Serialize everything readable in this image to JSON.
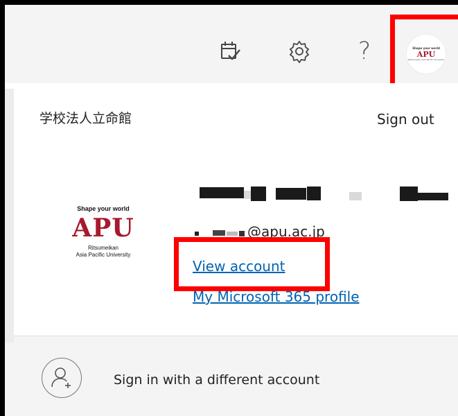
{
  "header": {
    "calendar_icon": "calendar-check-icon",
    "settings_icon": "gear-icon",
    "help_glyph": "?",
    "avatar": {
      "tagline": "Shape your world",
      "name": "APU",
      "subtitle": "Ritsumeikan Asia Pacific University"
    }
  },
  "account": {
    "organization": "学校法人立命館",
    "sign_out": "Sign out",
    "logo": {
      "tagline": "Shape your world",
      "name": "APU",
      "subtitle_line1": "Ritsumeikan",
      "subtitle_line2": "Asia Pacific University"
    },
    "email_domain": "@apu.ac.jp",
    "view_account": "View account",
    "profile_link": "My Microsoft 365 profile"
  },
  "footer": {
    "person_icon": "person-add-icon",
    "sign_in_other": "Sign in with a different account"
  },
  "colors": {
    "accent_link": "#0063b1",
    "highlight": "#ff0000",
    "brand_apu": "#a6192e"
  }
}
